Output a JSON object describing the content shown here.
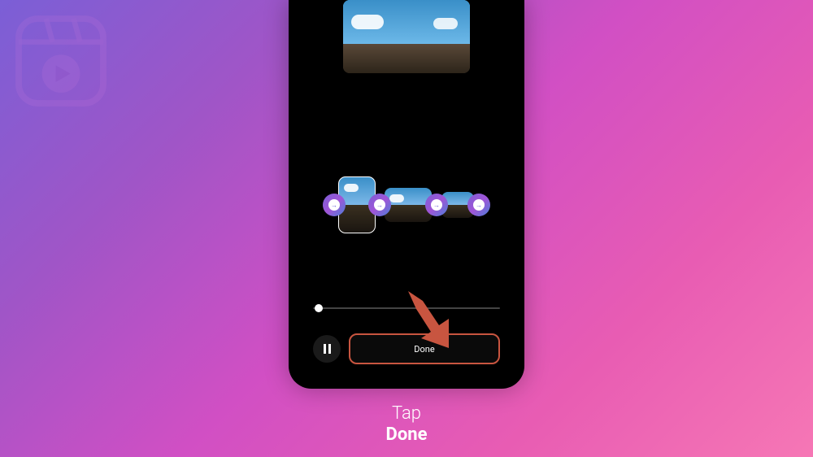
{
  "caption": {
    "line1": "Tap",
    "line2": "Done"
  },
  "controls": {
    "done_label": "Done"
  },
  "colors": {
    "highlight": "#c85540",
    "gradient_start": "#7b5fd6",
    "gradient_end": "#f677b5"
  }
}
